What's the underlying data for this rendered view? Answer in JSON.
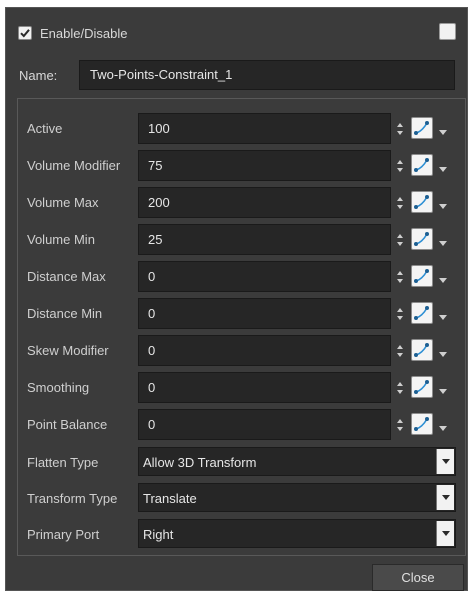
{
  "header": {
    "enable_label": "Enable/Disable",
    "enabled": true
  },
  "name": {
    "label": "Name:",
    "value": "Two-Points-Constraint_1"
  },
  "params": [
    {
      "label": "Active",
      "value": "100"
    },
    {
      "label": "Volume Modifier",
      "value": "75"
    },
    {
      "label": "Volume Max",
      "value": "200"
    },
    {
      "label": "Volume Min",
      "value": "25"
    },
    {
      "label": "Distance Max",
      "value": "0"
    },
    {
      "label": "Distance Min",
      "value": "0"
    },
    {
      "label": "Skew Modifier",
      "value": "0"
    },
    {
      "label": "Smoothing",
      "value": "0"
    },
    {
      "label": "Point Balance",
      "value": "0"
    }
  ],
  "selects": [
    {
      "label": "Flatten Type",
      "value": "Allow 3D Transform"
    },
    {
      "label": "Transform Type",
      "value": "Translate"
    },
    {
      "label": "Primary Port",
      "value": "Right"
    }
  ],
  "footer": {
    "close_label": "Close"
  },
  "colors": {
    "background": "#3b3b3b",
    "field": "#262626",
    "text": "#d6d6d6",
    "accent": "#2c8fd4"
  }
}
